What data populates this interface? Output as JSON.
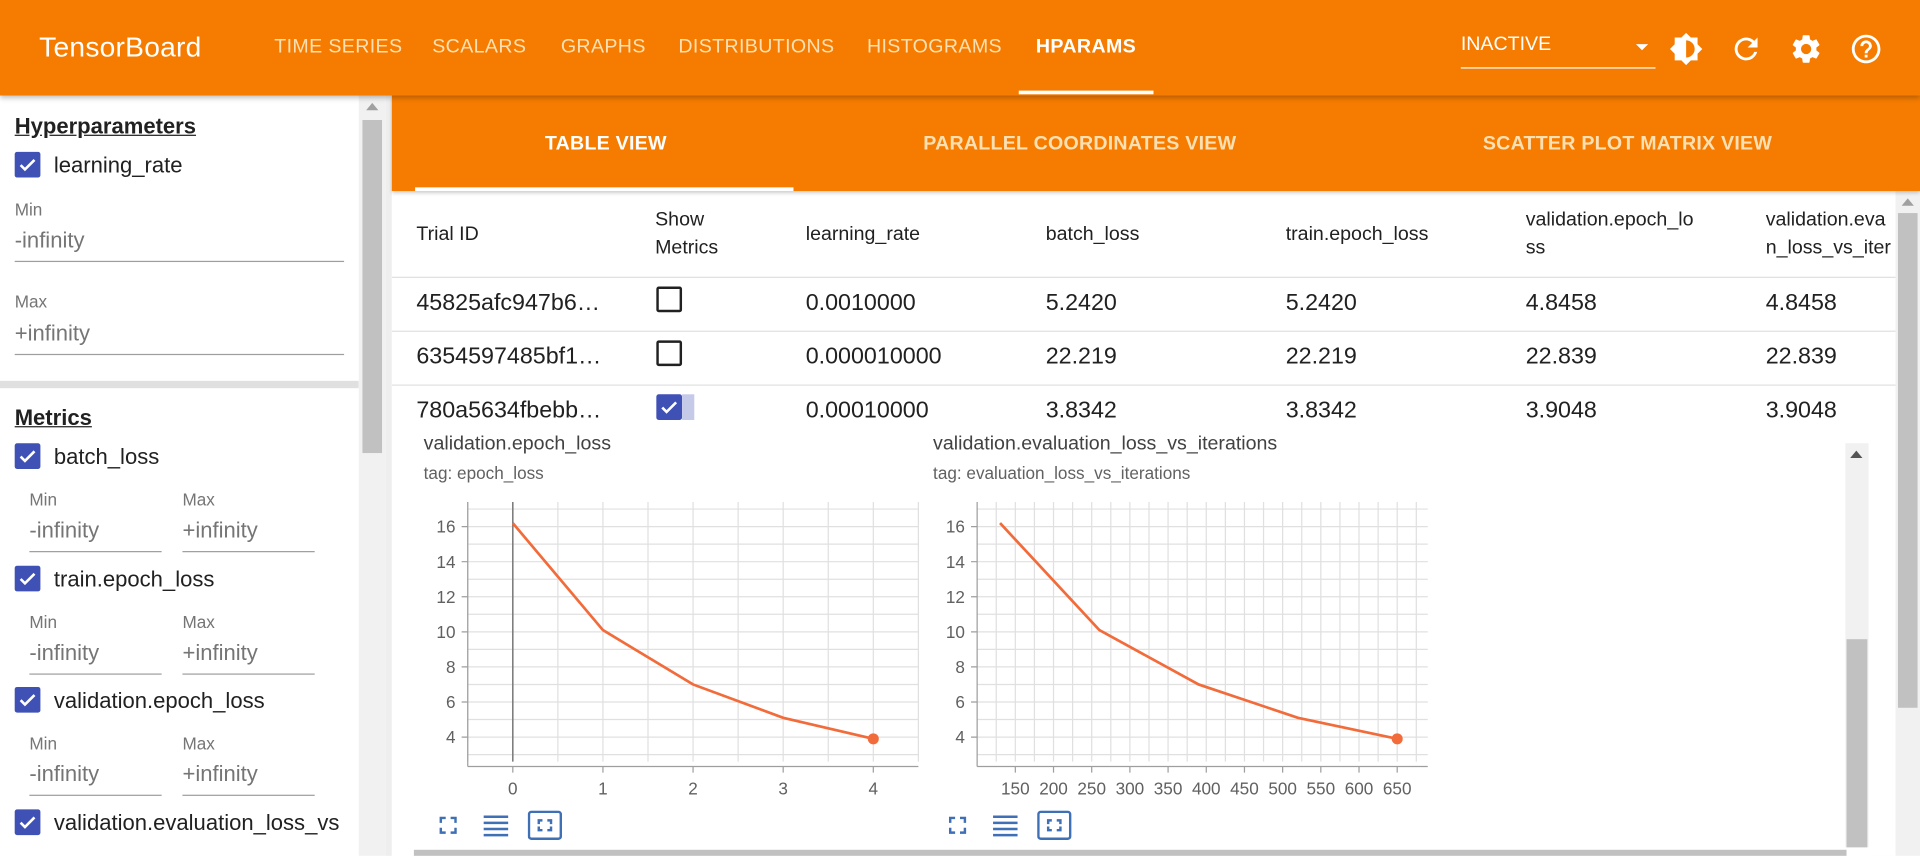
{
  "app": {
    "title": "TensorBoard"
  },
  "nav": {
    "tabs": [
      "TIME SERIES",
      "SCALARS",
      "GRAPHS",
      "DISTRIBUTIONS",
      "HISTOGRAMS",
      "HPARAMS"
    ],
    "active": "HPARAMS",
    "run_status": "INACTIVE"
  },
  "sidebar": {
    "hyperparameters_heading": "Hyperparameters",
    "hparam": {
      "name": "learning_rate",
      "checked": true,
      "min_label": "Min",
      "min_placeholder": "-infinity",
      "max_label": "Max",
      "max_placeholder": "+infinity"
    },
    "metrics_heading": "Metrics",
    "metrics": [
      {
        "name": "batch_loss",
        "checked": true,
        "min_label": "Min",
        "min_placeholder": "-infinity",
        "max_label": "Max",
        "max_placeholder": "+infinity"
      },
      {
        "name": "train.epoch_loss",
        "checked": true,
        "min_label": "Min",
        "min_placeholder": "-infinity",
        "max_label": "Max",
        "max_placeholder": "+infinity"
      },
      {
        "name": "validation.epoch_loss",
        "checked": true,
        "min_label": "Min",
        "min_placeholder": "-infinity",
        "max_label": "Max",
        "max_placeholder": "+infinity"
      },
      {
        "name": "validation.evaluation_loss_vs",
        "checked": true
      }
    ]
  },
  "subtabs": [
    "TABLE VIEW",
    "PARALLEL COORDINATES VIEW",
    "SCATTER PLOT MATRIX VIEW"
  ],
  "table": {
    "headers": [
      "Trial ID",
      "Show\nMetrics",
      "learning_rate",
      "batch_loss",
      "train.epoch_loss",
      "validation.epoch_lo\nss",
      "validation.eva\nn_loss_vs_iter"
    ],
    "rows": [
      {
        "trial_id": "45825afc947b6…",
        "show": false,
        "learning_rate": "0.0010000",
        "batch_loss": "5.2420",
        "train_epoch_loss": "5.2420",
        "validation_epoch_loss": "4.8458",
        "validation_eval": "4.8458"
      },
      {
        "trial_id": "6354597485bf1…",
        "show": false,
        "learning_rate": "0.000010000",
        "batch_loss": "22.219",
        "train_epoch_loss": "22.219",
        "validation_epoch_loss": "22.839",
        "validation_eval": "22.839"
      },
      {
        "trial_id": "780a5634fbebb…",
        "show": true,
        "learning_rate": "0.00010000",
        "batch_loss": "3.8342",
        "train_epoch_loss": "3.8342",
        "validation_epoch_loss": "3.9048",
        "validation_eval": "3.9048"
      }
    ]
  },
  "charts": {
    "line_color": "#f26b3a",
    "accent": "#f57c00",
    "checkbox_color": "#3f51b5"
  },
  "chart_data": [
    {
      "type": "line",
      "title": "validation.epoch_loss",
      "tag": "tag: epoch_loss",
      "x": [
        0,
        1,
        2,
        3,
        4
      ],
      "y": [
        16.2,
        10.1,
        7.0,
        5.1,
        3.9
      ],
      "xticks": [
        "0",
        "1",
        "2",
        "3",
        "4"
      ],
      "yticks": [
        "4",
        "6",
        "8",
        "10",
        "12",
        "14",
        "16"
      ],
      "xlim": [
        -0.5,
        4.5
      ],
      "ylim": [
        2.6,
        17.4
      ],
      "grid": true
    },
    {
      "type": "line",
      "title": "validation.evaluation_loss_vs_iterations",
      "tag": "tag: evaluation_loss_vs_iterations",
      "x": [
        130,
        260,
        390,
        520,
        650
      ],
      "y": [
        16.2,
        10.1,
        7.0,
        5.1,
        3.9
      ],
      "xticks": [
        "150",
        "200",
        "250",
        "300",
        "350",
        "400",
        "450",
        "500",
        "550",
        "600",
        "650"
      ],
      "yticks": [
        "4",
        "6",
        "8",
        "10",
        "12",
        "14",
        "16"
      ],
      "xlim": [
        100,
        690
      ],
      "ylim": [
        2.6,
        17.4
      ],
      "grid": true
    }
  ]
}
